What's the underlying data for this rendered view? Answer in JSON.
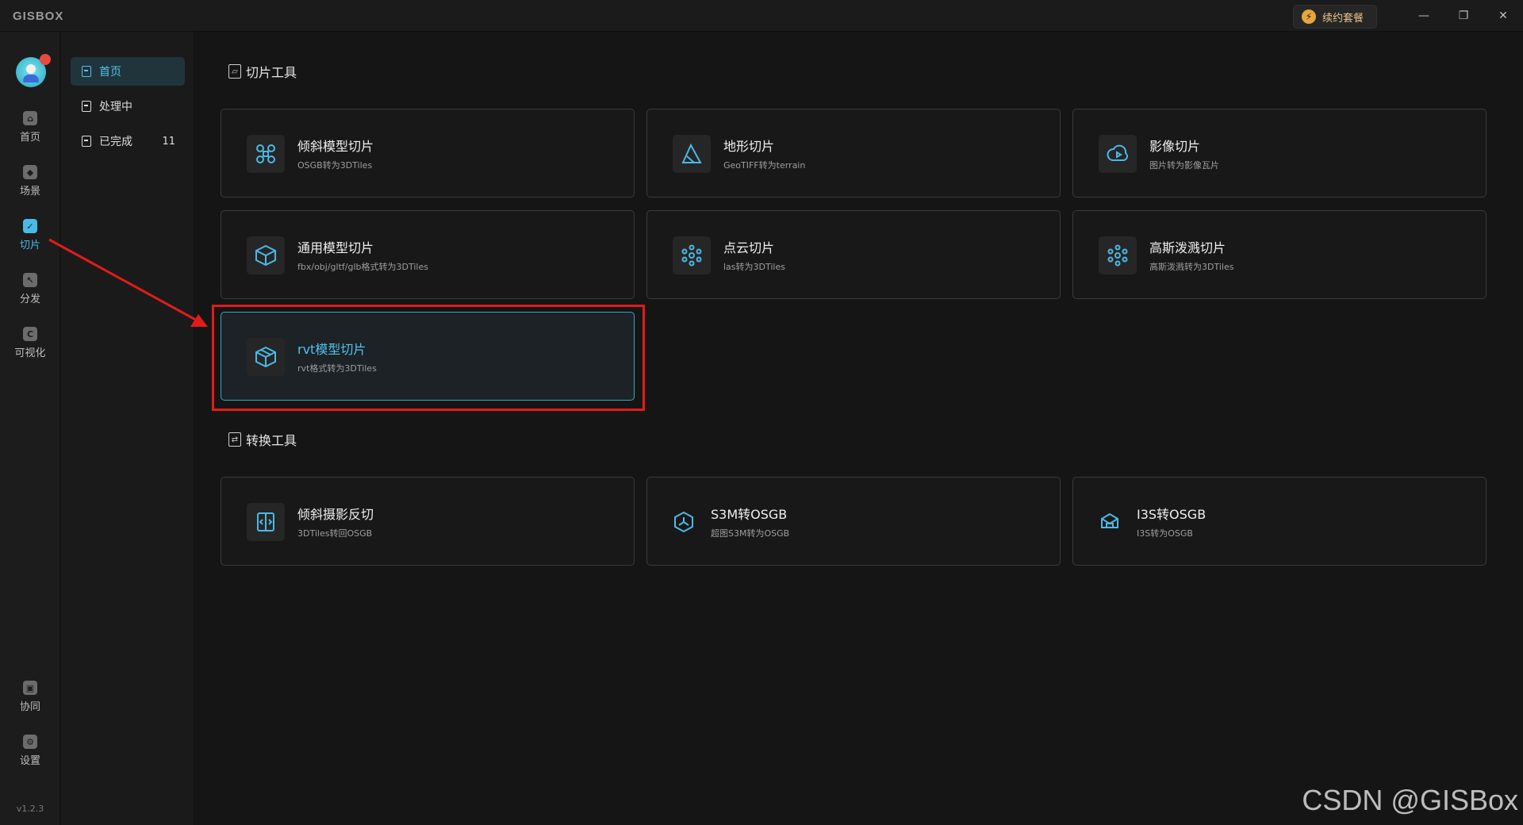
{
  "app": {
    "logo": "GISBOX",
    "version": "v1.2.3"
  },
  "titlebar": {
    "renew_label": "续约套餐",
    "minimize": "—",
    "restore": "❐",
    "close": "✕"
  },
  "rail": [
    {
      "label": "首页",
      "icon": "home-icon",
      "glyph": "⌂"
    },
    {
      "label": "场景",
      "icon": "cube-icon",
      "glyph": "◆"
    },
    {
      "label": "切片",
      "icon": "slice-icon",
      "glyph": "✓",
      "active": true
    },
    {
      "label": "分发",
      "icon": "distribute-icon",
      "glyph": "↖"
    },
    {
      "label": "可视化",
      "icon": "visualize-icon",
      "glyph": "C"
    },
    {
      "label": "协同",
      "icon": "lock-icon",
      "glyph": "▣"
    },
    {
      "label": "设置",
      "icon": "gear-icon",
      "glyph": "⚙"
    }
  ],
  "subnav": [
    {
      "label": "首页",
      "active": true
    },
    {
      "label": "处理中"
    },
    {
      "label": "已完成",
      "count": "11"
    }
  ],
  "sections": {
    "slice_tools": "切片工具",
    "convert_tools": "转换工具"
  },
  "slice_cards": [
    {
      "title": "倾斜模型切片",
      "subtitle": "OSGB转为3DTiles",
      "icon": "drone-icon"
    },
    {
      "title": "地形切片",
      "subtitle": "GeoTIFF转为terrain",
      "icon": "terrain-icon"
    },
    {
      "title": "影像切片",
      "subtitle": "图片转为影像瓦片",
      "icon": "cloud-play-icon"
    },
    {
      "title": "通用模型切片",
      "subtitle": "fbx/obj/gltf/glb格式转为3DTiles",
      "icon": "box-icon"
    },
    {
      "title": "点云切片",
      "subtitle": "las转为3DTiles",
      "icon": "point-cloud-icon"
    },
    {
      "title": "高斯泼溅切片",
      "subtitle": "高斯泼溅转为3DTiles",
      "icon": "gaussian-icon"
    },
    {
      "title": "rvt模型切片",
      "subtitle": "rvt格式转为3DTiles",
      "icon": "rvt-box-icon",
      "highlighted": true
    }
  ],
  "convert_cards": [
    {
      "title": "倾斜摄影反切",
      "subtitle": "3DTiles转回OSGB",
      "icon": "reverse-icon"
    },
    {
      "title": "S3M转OSGB",
      "subtitle": "超图S3M转为OSGB",
      "icon": "hexagon-icon"
    },
    {
      "title": "I3S转OSGB",
      "subtitle": "I3S转为OSGB",
      "icon": "package-icon"
    }
  ],
  "watermark": "CSDN @GISBox",
  "colors": {
    "accent": "#4bb9e6",
    "annotation": "#e21b1b",
    "background": "#151515"
  }
}
